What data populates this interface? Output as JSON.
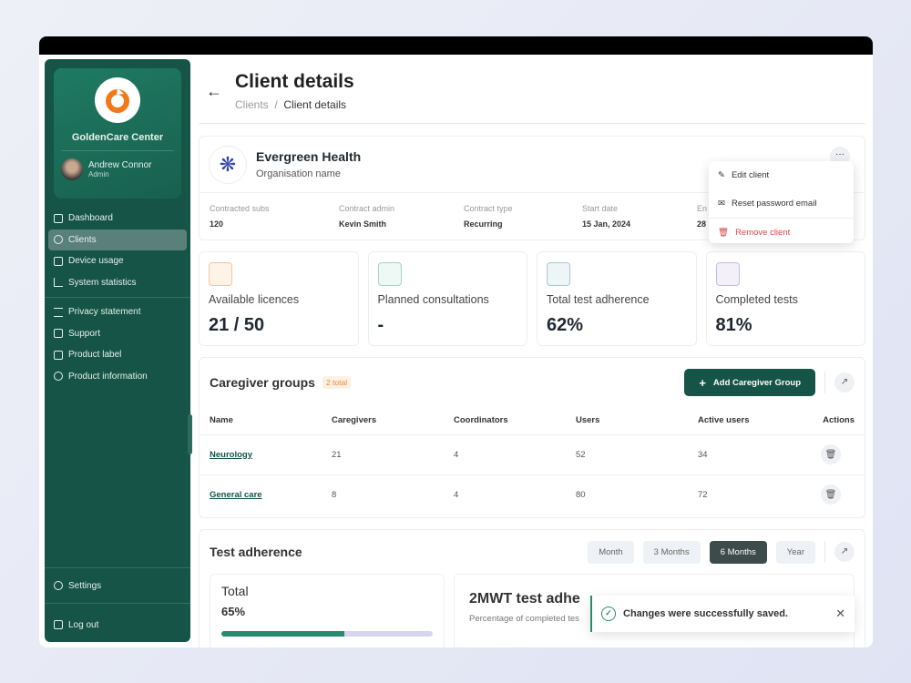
{
  "sidebar": {
    "org_name": "GoldenCare Center",
    "user_name": "Andrew Connor",
    "user_role": "Admin",
    "items": [
      {
        "label": "Dashboard",
        "icon": "grid-icon"
      },
      {
        "label": "Clients",
        "icon": "user-check-icon",
        "active": true
      },
      {
        "label": "Device usage",
        "icon": "phone-icon"
      },
      {
        "label": "System statistics",
        "icon": "chart-icon"
      }
    ],
    "items2": [
      {
        "label": "Privacy statement",
        "icon": "list-icon"
      },
      {
        "label": "Support",
        "icon": "help-icon"
      },
      {
        "label": "Product label",
        "icon": "folder-icon"
      },
      {
        "label": "Product information",
        "icon": "info-icon"
      }
    ],
    "settings": "Settings",
    "logout": "Log out"
  },
  "header": {
    "title": "Client details",
    "breadcrumb": [
      "Clients",
      "Client details"
    ]
  },
  "client": {
    "name": "Evergreen Health",
    "subtitle": "Organisation name",
    "fields": [
      {
        "label": "Contracted subs",
        "value": "120"
      },
      {
        "label": "Contract admin",
        "value": "Kevin Smith"
      },
      {
        "label": "Contract type",
        "value": "Recurring"
      },
      {
        "label": "Start date",
        "value": "15 Jan, 2024"
      },
      {
        "label": "En",
        "value": "28"
      }
    ],
    "menu": [
      "Edit client",
      "Reset password email",
      "Remove client"
    ]
  },
  "stats": [
    {
      "label": "Available licences",
      "value": "21 / 50",
      "color": "#e8893a"
    },
    {
      "label": "Planned consultations",
      "value": "-",
      "color": "#2b8a6d"
    },
    {
      "label": "Total test adherence",
      "value": "62%",
      "color": "#4a8a9a"
    },
    {
      "label": "Completed tests",
      "value": "81%",
      "color": "#7b6bb8"
    }
  ],
  "groups": {
    "title": "Caregiver groups",
    "badge": "2 total",
    "add_label": "Add Caregiver Group",
    "columns": [
      "Name",
      "Caregivers",
      "Coordinators",
      "Users",
      "Active users",
      "Actions"
    ],
    "rows": [
      [
        "Neurology",
        "21",
        "4",
        "52",
        "34"
      ],
      [
        "General care",
        "8",
        "4",
        "80",
        "72"
      ]
    ]
  },
  "adherence": {
    "title": "Test adherence",
    "periods": [
      "Month",
      "3 Months",
      "6 Months",
      "Year"
    ],
    "selected": "6 Months",
    "total_label": "Total",
    "total_value": "65%",
    "progress_fill_percent": 58,
    "chart_title": "2MWT test adhe",
    "chart_subtitle": "Percentage of completed tes"
  },
  "toast": {
    "message": "Changes were successfully saved."
  }
}
